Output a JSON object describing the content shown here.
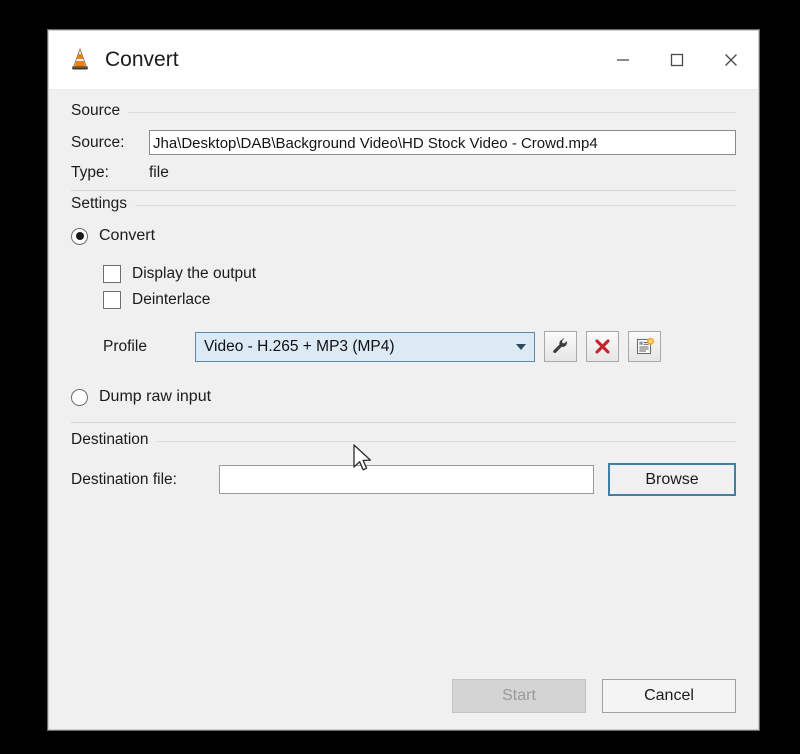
{
  "window": {
    "title": "Convert",
    "icon": "vlc-cone-icon",
    "controls": {
      "minimize": "minimize-icon",
      "maximize": "maximize-icon",
      "close": "close-icon"
    }
  },
  "source": {
    "group_title": "Source",
    "source_label": "Source:",
    "source_path": "Jha\\Desktop\\DAB\\Background Video\\HD Stock Video - Crowd.mp4",
    "type_label": "Type:",
    "type_value": "file"
  },
  "settings": {
    "group_title": "Settings",
    "convert_radio": {
      "label": "Convert",
      "selected": true
    },
    "display_output_checkbox": {
      "label": "Display the output",
      "checked": false
    },
    "deinterlace_checkbox": {
      "label": "Deinterlace",
      "checked": false
    },
    "profile": {
      "label": "Profile",
      "selected": "Video - H.265 + MP3 (MP4)",
      "focused": true
    },
    "profile_buttons": {
      "edit": "wrench-icon",
      "delete": "red-x-icon",
      "create": "new-profile-icon"
    },
    "dump_radio": {
      "label": "Dump raw input",
      "selected": false
    }
  },
  "destination": {
    "group_title": "Destination",
    "file_label": "Destination file:",
    "file_value": "",
    "file_placeholder": "",
    "browse_label": "Browse"
  },
  "footer": {
    "start_label": "Start",
    "start_enabled": false,
    "cancel_label": "Cancel"
  },
  "colors": {
    "combo_focus_border": "#5a8cb0",
    "combo_fill": "#dceaf6",
    "browse_focus_border": "#3f7fa8",
    "delete_icon": "#c1272d",
    "badge": "#f5a623",
    "window_bg": "#f0f0f0"
  }
}
